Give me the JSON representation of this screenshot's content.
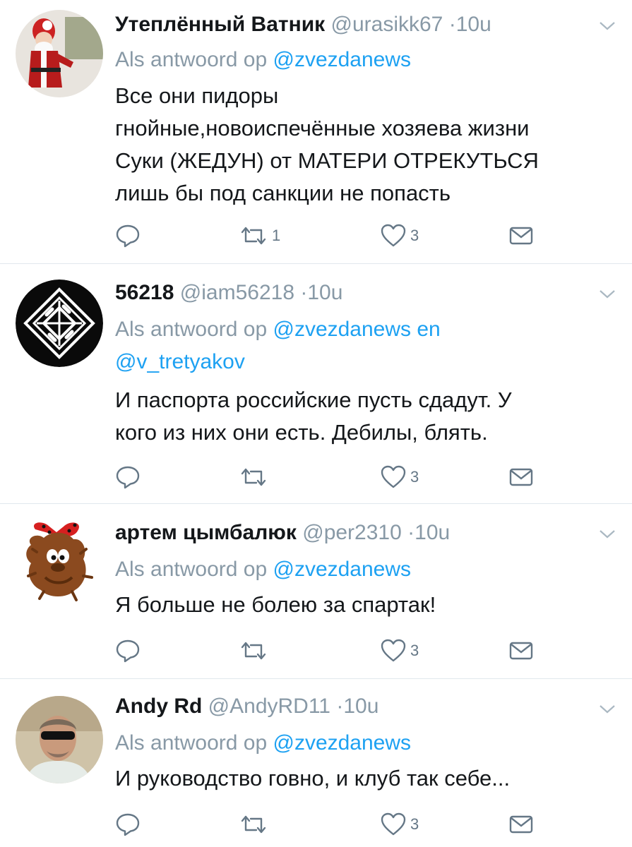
{
  "reply_prefix": "Als antwoord op",
  "tweets": [
    {
      "name": "Утеплённый Ватник",
      "handle": "@urasikk67",
      "time": "10u",
      "replying_to": [
        "@zvezdanews"
      ],
      "text_lines": [
        "Все они пидоры",
        "гнойные,новоиспечённые хозяева жизни",
        "Суки (ЖЕДУН) от МАТЕРИ ОТРЕКУТЬСЯ",
        "лишь бы под санкции не попасть"
      ],
      "retweets": "1",
      "likes": "3",
      "avatar": "santa-figure"
    },
    {
      "name": "56218",
      "handle": "@iam56218",
      "time": "10u",
      "replying_to": [
        "@zvezdanews",
        "@v_tretyakov"
      ],
      "joiner": "en",
      "text_lines": [
        "И паспорта российские пусть сдадут. У",
        "кого из них они есть. Дебилы, блять."
      ],
      "retweets": "",
      "likes": "3",
      "avatar": "geometric-logo"
    },
    {
      "name": "артем цымбалюк",
      "handle": "@per2310",
      "time": "10u",
      "replying_to": [
        "@zvezdanews"
      ],
      "text_lines": [
        "Я больше не болею за спартак!"
      ],
      "retweets": "",
      "likes": "3",
      "avatar": "cartoon-creature"
    },
    {
      "name": "Andy Rd",
      "handle": "@AndyRD11",
      "time": "10u",
      "replying_to": [
        "@zvezdanews"
      ],
      "text_lines": [
        "И руководство говно, и клуб так себе..."
      ],
      "retweets": "",
      "likes": "3",
      "avatar": "man-sunglasses-photo"
    }
  ],
  "colors": {
    "accent": "#1da1f2",
    "muted": "#8899a6",
    "icon": "#657786",
    "divider": "#e1e8ed"
  },
  "icons": [
    "reply-icon",
    "retweet-icon",
    "like-icon",
    "message-icon",
    "chevron-down-icon"
  ]
}
